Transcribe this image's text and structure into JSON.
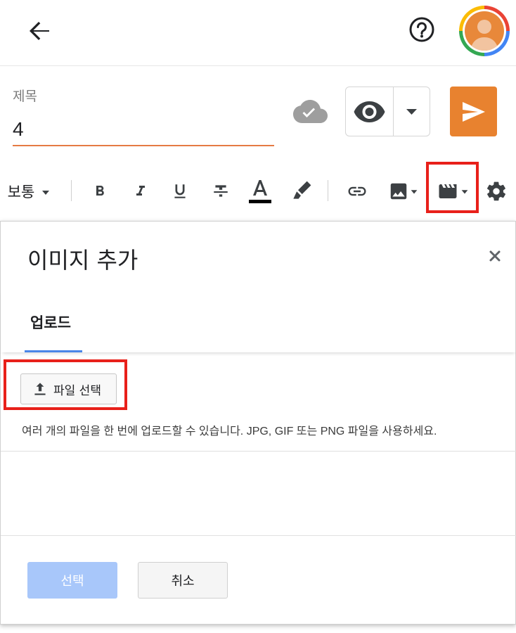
{
  "header": {
    "back_icon": "arrow-left-icon",
    "help_icon": "help-circle-icon",
    "avatar_icon": "account-avatar"
  },
  "editor": {
    "title_label": "제목",
    "title_value": "4",
    "save_status_icon": "cloud-saved-icon",
    "preview_icon": "eye-icon",
    "publish_icon": "send-icon",
    "accent_color": "#e8822f"
  },
  "toolbar": {
    "format_label": "보통",
    "items": [
      "bold-icon",
      "italic-icon",
      "underline-icon",
      "strikethrough-icon",
      "text-color-icon",
      "highlight-icon",
      "link-icon",
      "image-icon",
      "video-icon",
      "settings-icon"
    ]
  },
  "dialog": {
    "title": "이미지 추가",
    "close_icon": "close-icon",
    "tabs": [
      {
        "label": "업로드",
        "active": true
      }
    ],
    "file_button_label": "파일 선택",
    "help_text": "여러 개의 파일을 한 번에 업로드할 수 있습니다. JPG, GIF 또는 PNG 파일을 사용하세요.",
    "select_label": "선택",
    "cancel_label": "취소",
    "select_color": "#a8c7fa"
  },
  "highlight_color": "#e8201a"
}
